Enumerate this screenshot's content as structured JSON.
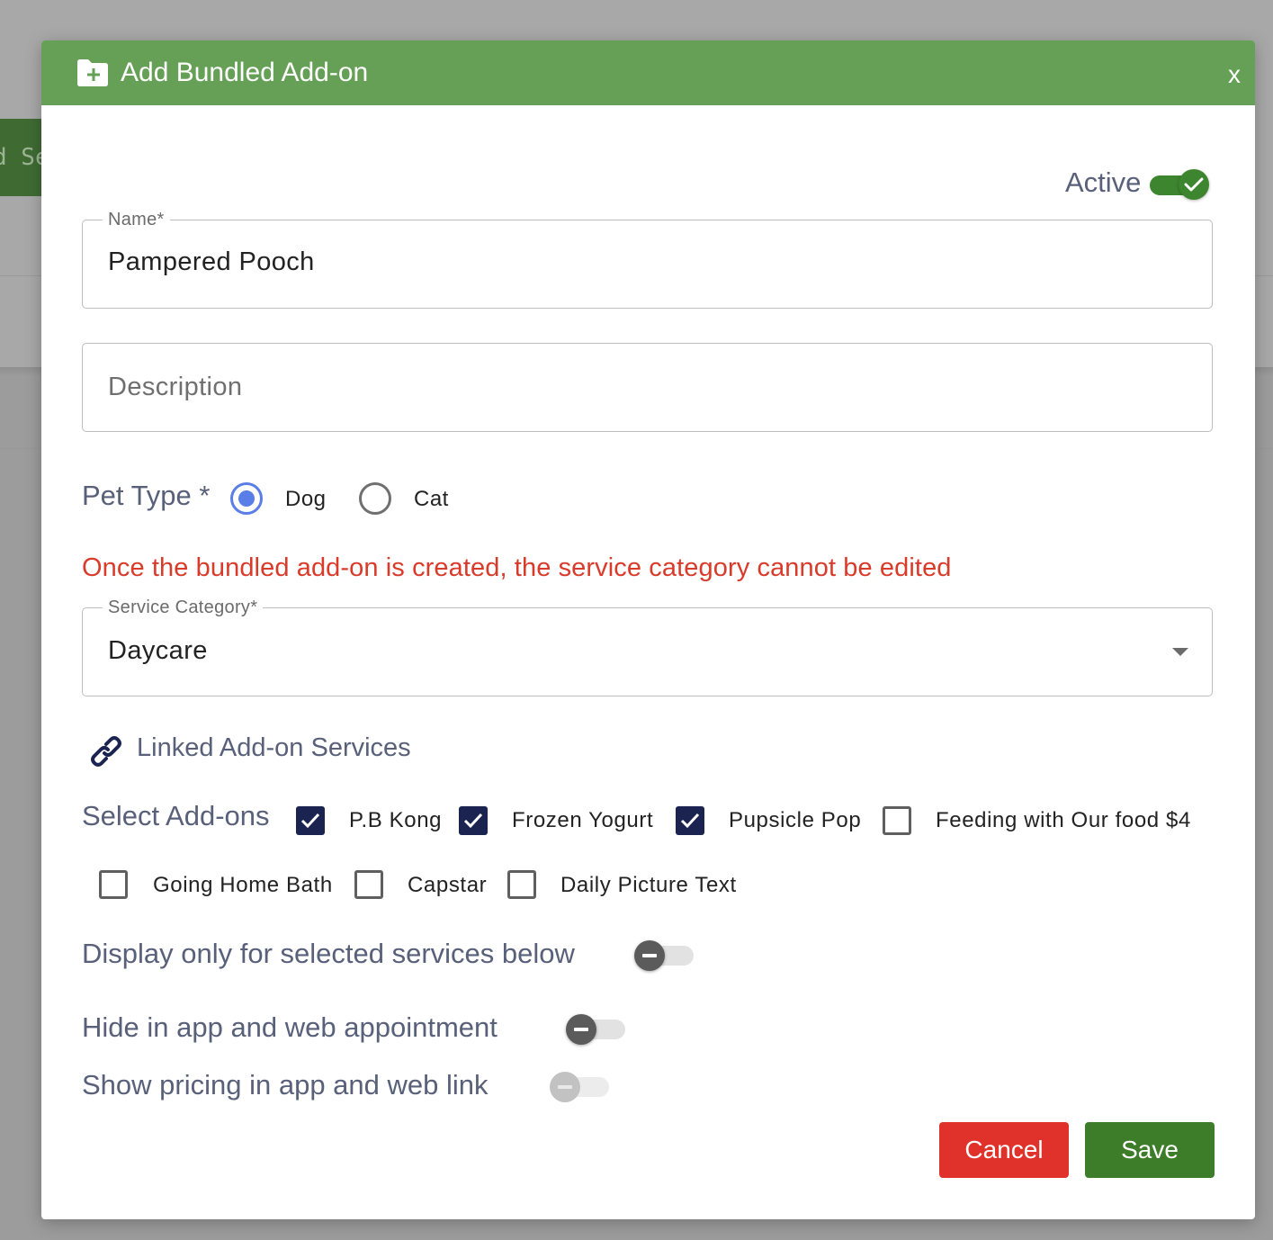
{
  "background": {
    "partial_button_text": "d Se"
  },
  "modal": {
    "title": "Add Bundled Add-on",
    "close_label": "x",
    "header_icon": "folder-plus-icon",
    "header_color": "#65a056"
  },
  "active": {
    "label": "Active",
    "on": true
  },
  "name_field": {
    "label": "Name*",
    "value": "Pampered Pooch"
  },
  "description_field": {
    "placeholder": "Description",
    "value": ""
  },
  "pet_type": {
    "label": "Pet Type *",
    "options": [
      {
        "label": "Dog",
        "selected": true
      },
      {
        "label": "Cat",
        "selected": false
      }
    ]
  },
  "warning_text": "Once the bundled add-on is created, the service category cannot be edited",
  "service_category": {
    "label": "Service Category*",
    "value": "Daycare"
  },
  "linked": {
    "icon": "link-icon",
    "label": "Linked Add-on Services"
  },
  "addons": {
    "label": "Select Add-ons",
    "items": [
      {
        "label": "P.B Kong",
        "checked": true
      },
      {
        "label": "Frozen Yogurt",
        "checked": true
      },
      {
        "label": "Pupsicle Pop",
        "checked": true
      },
      {
        "label": "Feeding with Our food $4",
        "checked": false
      },
      {
        "label": "Going Home Bath",
        "checked": false
      },
      {
        "label": "Capstar",
        "checked": false
      },
      {
        "label": "Daily Picture Text",
        "checked": false
      }
    ]
  },
  "options": [
    {
      "label": "Display only for selected services below",
      "on": false,
      "disabled": false
    },
    {
      "label": "Hide in app and web appointment",
      "on": false,
      "disabled": false
    },
    {
      "label": "Show pricing in app and web link",
      "on": false,
      "disabled": true
    }
  ],
  "buttons": {
    "cancel": "Cancel",
    "save": "Save"
  },
  "colors": {
    "cancel": "#e0322a",
    "save": "#3d7d2a",
    "warning": "#d93b2b",
    "checkbox_checked": "#1b2450",
    "radio_selected": "#5a7ee8"
  }
}
